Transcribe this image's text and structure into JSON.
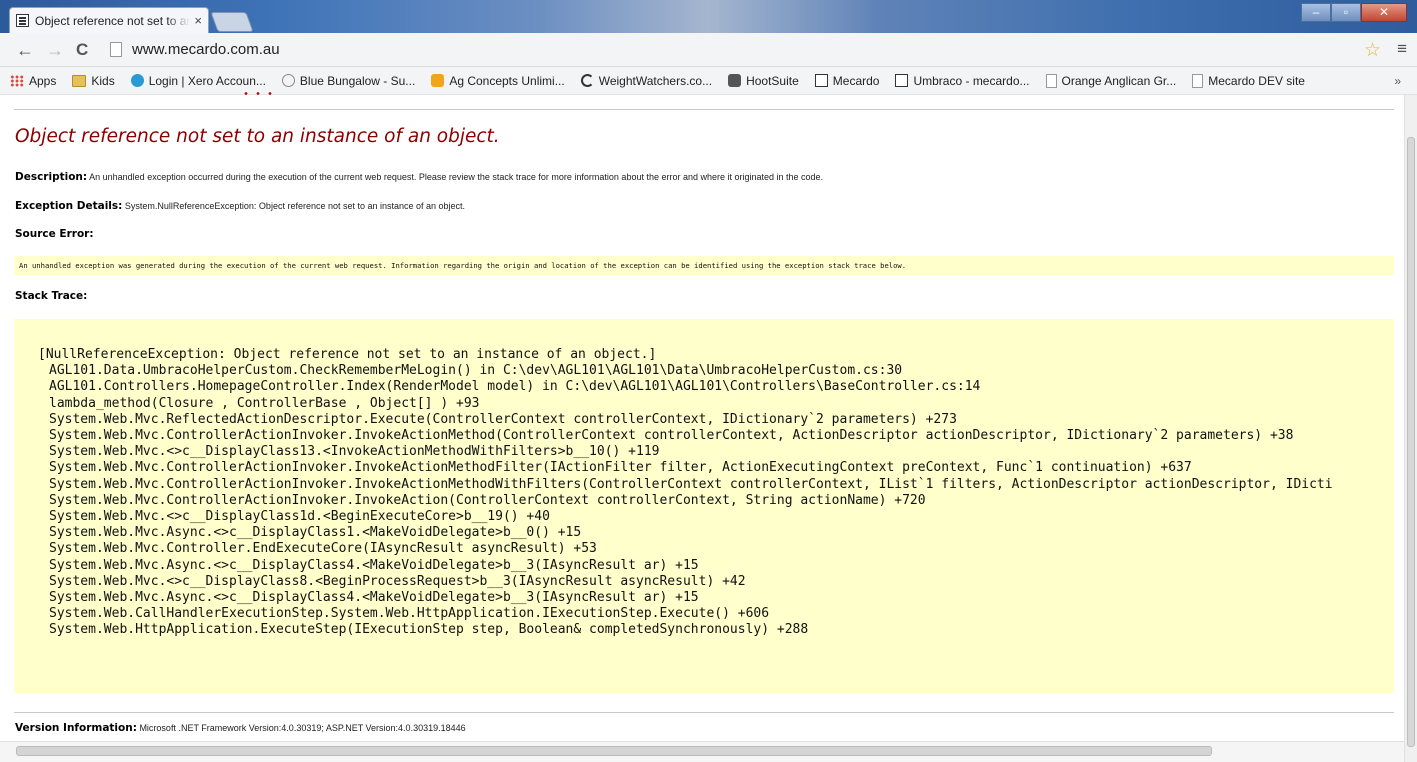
{
  "browser": {
    "tab_title": "Object reference not set to an instance of an object.",
    "tab_close": "×",
    "url": "www.mecardo.com.au",
    "nav_back": "←",
    "nav_forward": "→",
    "nav_reload": "C",
    "star": "☆",
    "menu": "≡",
    "window_min": "–",
    "window_max": "▫",
    "window_close": "✕"
  },
  "bookmarks": [
    {
      "label": "Apps",
      "icon": "apps-icon"
    },
    {
      "label": "Kids",
      "icon": "folder-icon"
    },
    {
      "label": "Login | Xero Accoun...",
      "icon": "xero-icon"
    },
    {
      "label": "Blue Bungalow - Su...",
      "icon": "blue-icon"
    },
    {
      "label": "Ag Concepts Unlimi...",
      "icon": "ag-icon"
    },
    {
      "label": "WeightWatchers.co...",
      "icon": "ww-icon"
    },
    {
      "label": "HootSuite",
      "icon": "hoot-icon"
    },
    {
      "label": "Mecardo",
      "icon": "mec-icon"
    },
    {
      "label": "Umbraco - mecardo...",
      "icon": "mec-icon"
    },
    {
      "label": "Orange Anglican Gr...",
      "icon": "page-bm-icon"
    },
    {
      "label": "Mecardo DEV site",
      "icon": "page-bm-icon"
    }
  ],
  "bookmarks_more": "»",
  "error": {
    "title": "Object reference not set to an instance of an object.",
    "description_label": "Description:",
    "description_text": "An unhandled exception occurred during the execution of the current web request. Please review the stack trace for more information about the error and where it originated in the code.",
    "exception_label": "Exception Details:",
    "exception_text": "System.NullReferenceException: Object reference not set to an instance of an object.",
    "source_error_label": "Source Error:",
    "source_error_text": "An unhandled exception was generated during the execution of the current web request. Information regarding the origin and location of the exception can be identified using the exception stack trace below.",
    "stack_trace_label": "Stack Trace:",
    "stack_header": "[NullReferenceException: Object reference not set to an instance of an object.]",
    "stack_frames": [
      "AGL101.Data.UmbracoHelperCustom.CheckRememberMeLogin() in C:\\dev\\AGL101\\AGL101\\Data\\UmbracoHelperCustom.cs:30",
      "AGL101.Controllers.HomepageController.Index(RenderModel model) in C:\\dev\\AGL101\\AGL101\\Controllers\\BaseController.cs:14",
      "lambda_method(Closure , ControllerBase , Object[] ) +93",
      "System.Web.Mvc.ReflectedActionDescriptor.Execute(ControllerContext controllerContext, IDictionary`2 parameters) +273",
      "System.Web.Mvc.ControllerActionInvoker.InvokeActionMethod(ControllerContext controllerContext, ActionDescriptor actionDescriptor, IDictionary`2 parameters) +38",
      "System.Web.Mvc.<>c__DisplayClass13.<InvokeActionMethodWithFilters>b__10() +119",
      "System.Web.Mvc.ControllerActionInvoker.InvokeActionMethodFilter(IActionFilter filter, ActionExecutingContext preContext, Func`1 continuation) +637",
      "System.Web.Mvc.ControllerActionInvoker.InvokeActionMethodWithFilters(ControllerContext controllerContext, IList`1 filters, ActionDescriptor actionDescriptor, IDicti",
      "System.Web.Mvc.ControllerActionInvoker.InvokeAction(ControllerContext controllerContext, String actionName) +720",
      "System.Web.Mvc.<>c__DisplayClass1d.<BeginExecuteCore>b__19() +40",
      "System.Web.Mvc.Async.<>c__DisplayClass1.<MakeVoidDelegate>b__0() +15",
      "System.Web.Mvc.Controller.EndExecuteCore(IAsyncResult asyncResult) +53",
      "System.Web.Mvc.Async.<>c__DisplayClass4.<MakeVoidDelegate>b__3(IAsyncResult ar) +15",
      "System.Web.Mvc.<>c__DisplayClass8.<BeginProcessRequest>b__3(IAsyncResult asyncResult) +42",
      "System.Web.Mvc.Async.<>c__DisplayClass4.<MakeVoidDelegate>b__3(IAsyncResult ar) +15",
      "System.Web.CallHandlerExecutionStep.System.Web.HttpApplication.IExecutionStep.Execute() +606",
      "System.Web.HttpApplication.ExecuteStep(IExecutionStep step, Boolean& completedSynchronously) +288"
    ],
    "version_label": "Version Information:",
    "version_text": "Microsoft .NET Framework Version:4.0.30319; ASP.NET Version:4.0.30319.18446"
  },
  "colors": {
    "error_title": "#8b0000",
    "highlight_bg": "#ffffcc"
  }
}
